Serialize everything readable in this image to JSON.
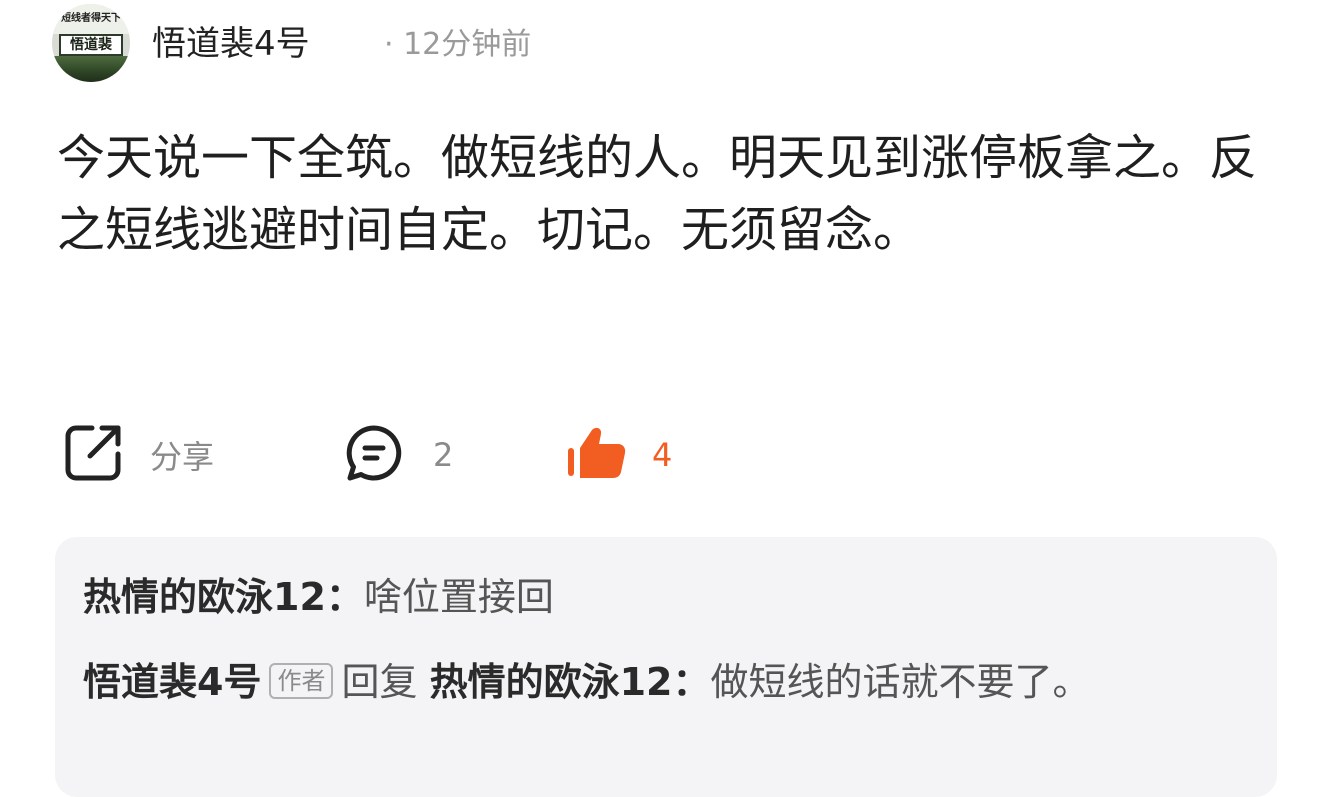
{
  "post": {
    "avatar": {
      "line_top": "短线者得天下",
      "line_mid": "悟道裴"
    },
    "author": "悟道裴4号",
    "meta": "· 12分钟前",
    "text": "今天说一下全筑。做短线的人。明天见到涨停板拿之。反之短线逃避时间自定。切记。无须留念。"
  },
  "actions": {
    "share": {
      "icon": "share-icon",
      "label": "分享"
    },
    "comment": {
      "icon": "comment-icon",
      "count": "2"
    },
    "like": {
      "icon": "thumbs-up-icon",
      "count": "4",
      "color": "#f25d22"
    }
  },
  "comments": [
    {
      "user": "热情的欧泳12：",
      "text": "啥位置接回"
    },
    {
      "user": "悟道裴4号",
      "badge": "作者",
      "reply_word": "回复",
      "reply_to": "热情的欧泳12：",
      "text": "做短线的话就不要了。"
    }
  ]
}
